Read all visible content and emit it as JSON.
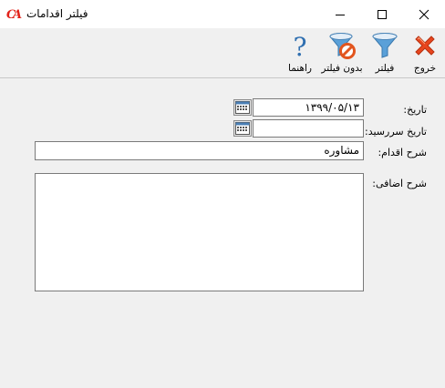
{
  "window": {
    "title": "فیلتر اقدامات",
    "logo_text": "CA",
    "colors": {
      "accent": "#e2231a",
      "filter_blue": "#5aa0d8",
      "titlebar": "#ffffff",
      "background": "#f0f0f0"
    }
  },
  "toolbar": {
    "buttons": [
      {
        "icon": "exit-icon",
        "label": "خروج"
      },
      {
        "icon": "filter-icon",
        "label": "فیلتر"
      },
      {
        "icon": "no-filter-icon",
        "label": "بدون فیلتر"
      },
      {
        "icon": "help-icon",
        "label": "راهنما"
      }
    ]
  },
  "form": {
    "date_label": "تاریخ:",
    "date_value": "۱۳۹۹/۰۵/۱۳",
    "due_date_label": "تاریخ سررسید:",
    "due_date_value": "",
    "action_desc_label": "شرح اقدام:",
    "action_desc_value": "مشاوره",
    "extra_desc_label": "شرح اضافی:",
    "extra_desc_value": ""
  }
}
